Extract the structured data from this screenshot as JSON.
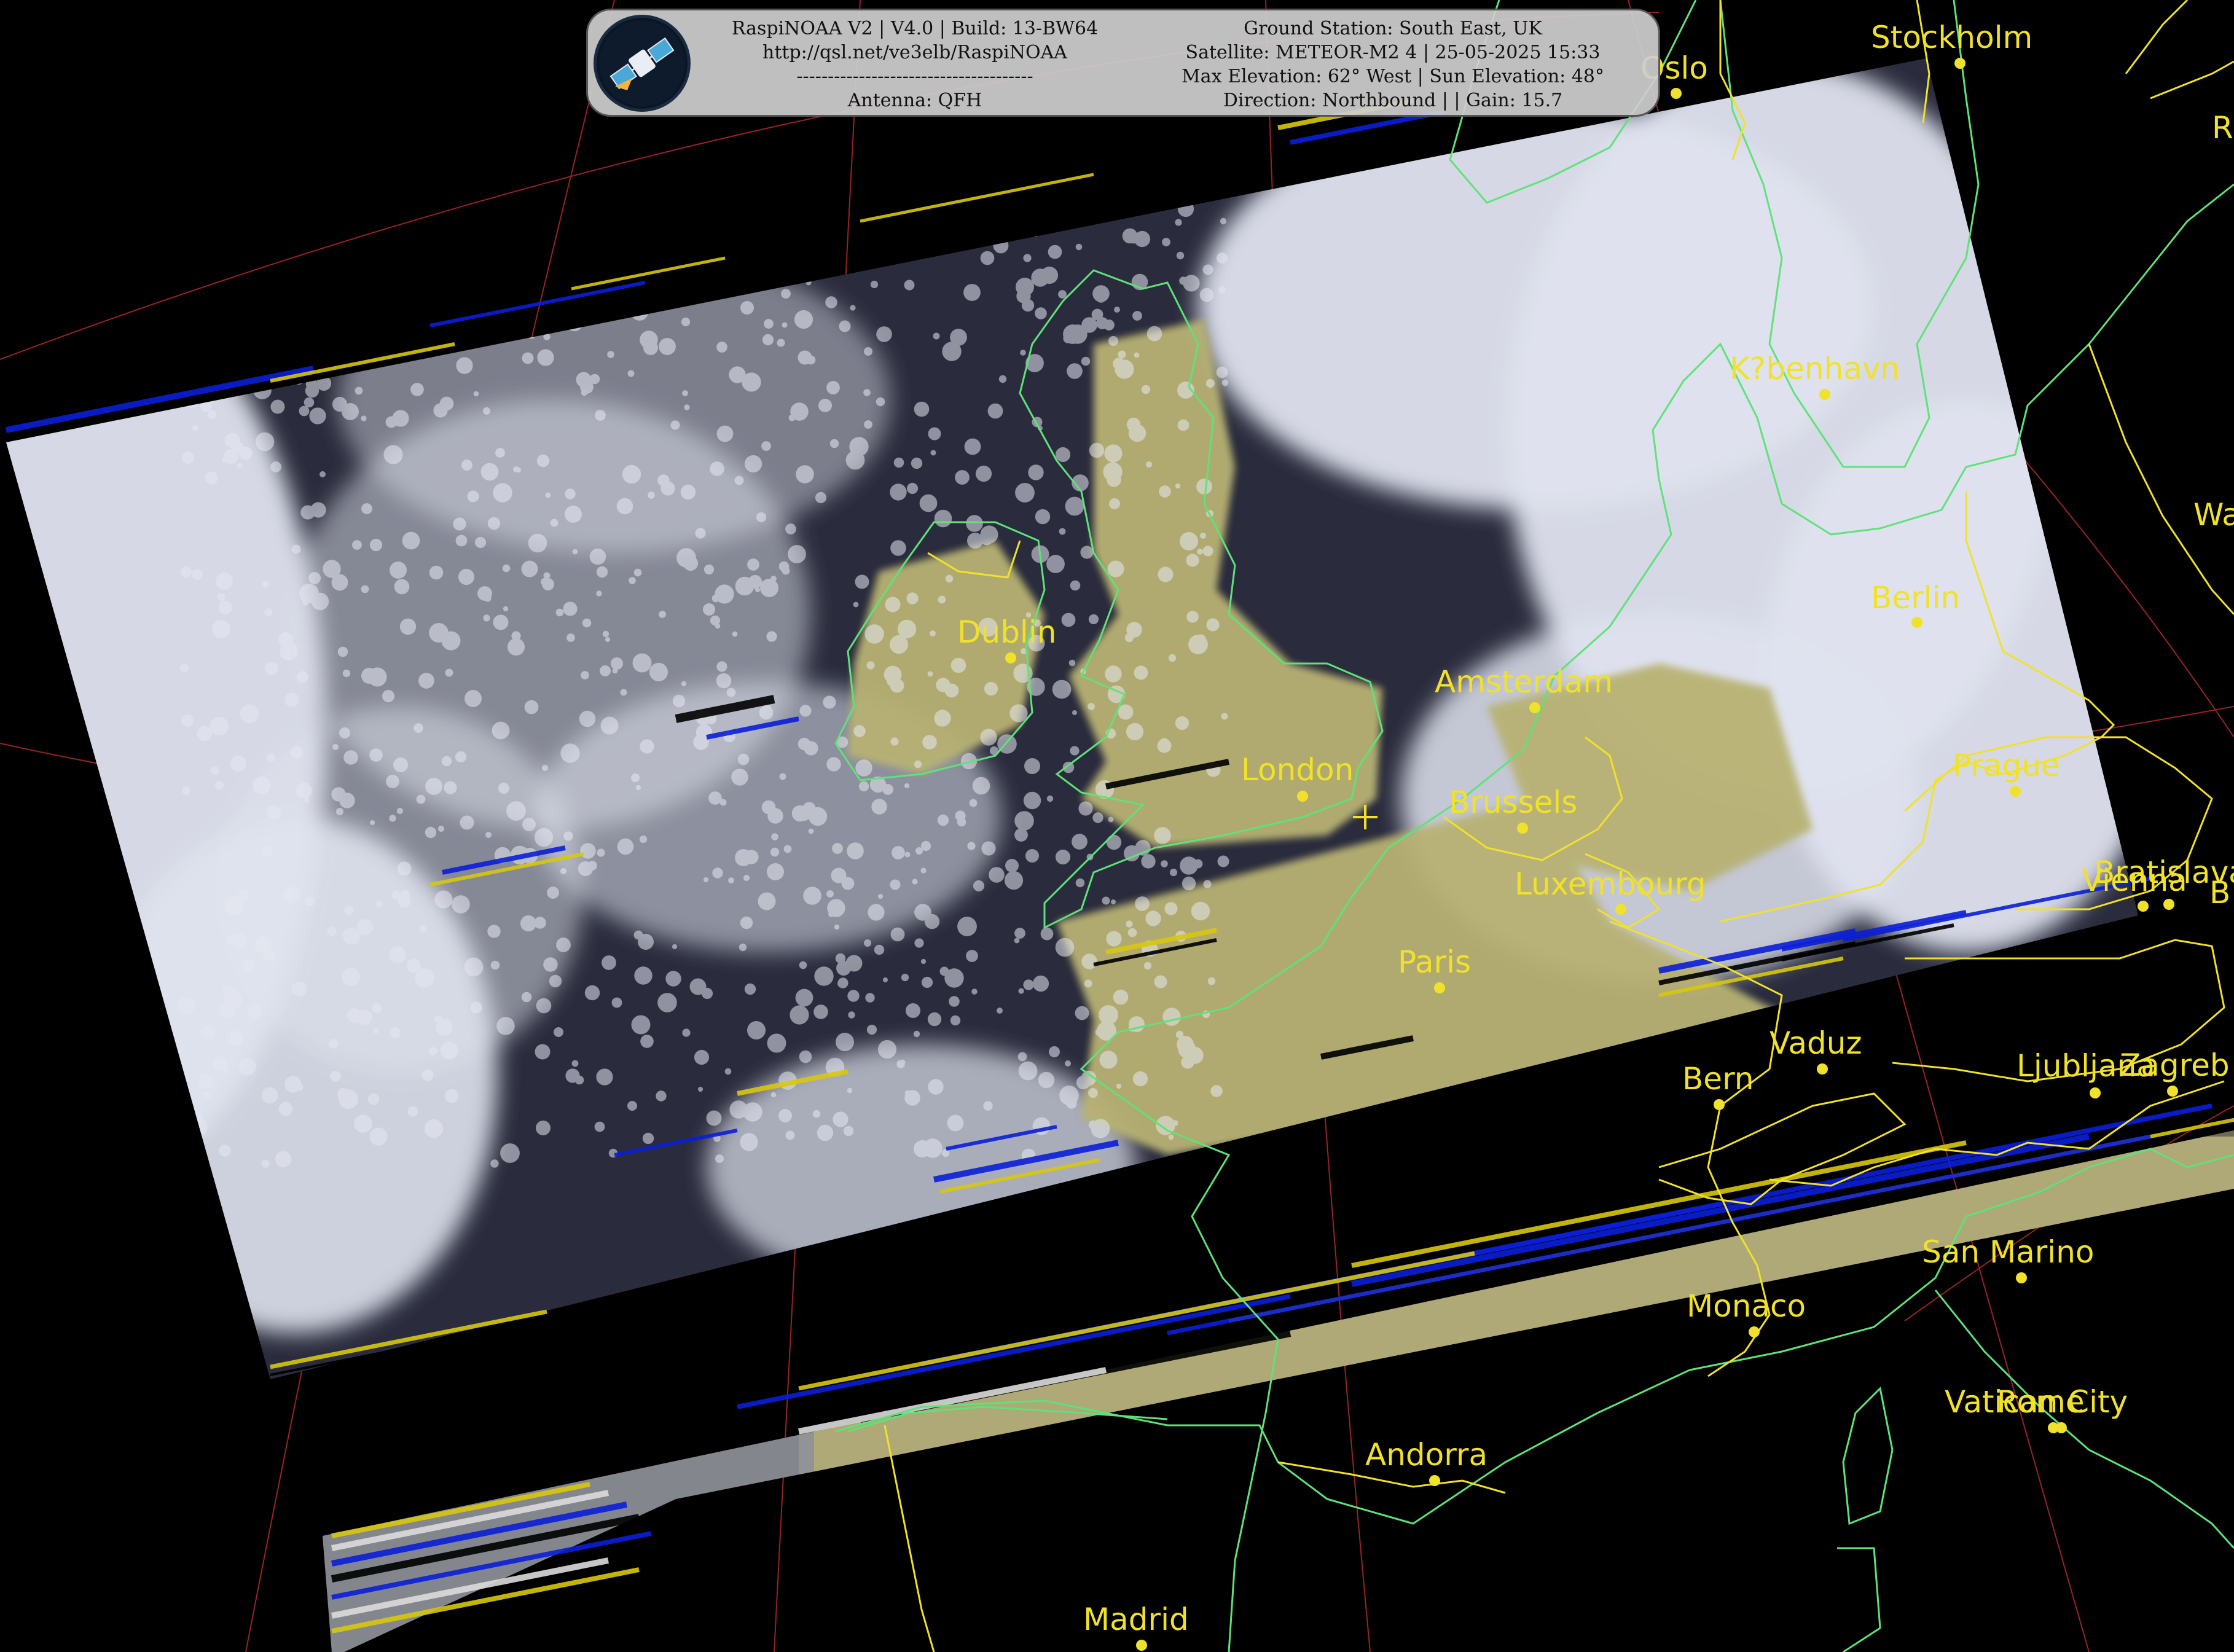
{
  "header": {
    "left_lines": [
      "RaspiNOAA V2 | V4.0 | Build: 13-BW64",
      "http://qsl.net/ve3elb/RaspiNOAA",
      "--------------------------------------",
      "Antenna: QFH"
    ],
    "right_lines": [
      "Ground Station: South East, UK",
      "Satellite: METEOR-M2 4 | 25-05-2025 15:33",
      "Max Elevation: 62° West | Sun Elevation: 48°",
      "Direction: Northbound |  | Gain: 15.7"
    ],
    "logo_icon": "satellite-icon"
  },
  "cities": [
    {
      "id": "stockholm",
      "label": "Stockholm"
    },
    {
      "id": "oslo",
      "label": "Oslo"
    },
    {
      "id": "copenhagen",
      "label": "K?benhavn"
    },
    {
      "id": "berlin",
      "label": "Berlin"
    },
    {
      "id": "amsterdam",
      "label": "Amsterdam"
    },
    {
      "id": "dublin",
      "label": "Dublin"
    },
    {
      "id": "london",
      "label": "London"
    },
    {
      "id": "brussels",
      "label": "Brussels"
    },
    {
      "id": "luxembourg",
      "label": "Luxembourg"
    },
    {
      "id": "prague",
      "label": "Prague"
    },
    {
      "id": "bratislava",
      "label": "Bratislava"
    },
    {
      "id": "vienna",
      "label": "Vienna"
    },
    {
      "id": "paris",
      "label": "Paris"
    },
    {
      "id": "vaduz",
      "label": "Vaduz"
    },
    {
      "id": "bern",
      "label": "Bern"
    },
    {
      "id": "ljubljana",
      "label": "Ljubljana"
    },
    {
      "id": "zagreb",
      "label": "Zagreb"
    },
    {
      "id": "san-marino",
      "label": "San Marino"
    },
    {
      "id": "monaco",
      "label": "Monaco"
    },
    {
      "id": "vatican",
      "label": "Vatican City"
    },
    {
      "id": "rome",
      "label": "Rome"
    },
    {
      "id": "andorra",
      "label": "Andorra"
    },
    {
      "id": "madrid",
      "label": "Madrid"
    }
  ],
  "edge_labels": [
    {
      "id": "riga",
      "label": "R"
    },
    {
      "id": "warsaw",
      "label": "Wa"
    },
    {
      "id": "budapest",
      "label": "B"
    }
  ],
  "colors": {
    "background": "#000000",
    "coastline": "#5fe27a",
    "border": "#f0e22a",
    "graticule": "#b22a2a",
    "label": "#f0e22a",
    "cloud": "#dfe3ee",
    "sea": "#2a2c3d",
    "land": "#b8b273",
    "noise_blue": "#0b1fd8",
    "noise_yellow": "#d8c80e"
  }
}
